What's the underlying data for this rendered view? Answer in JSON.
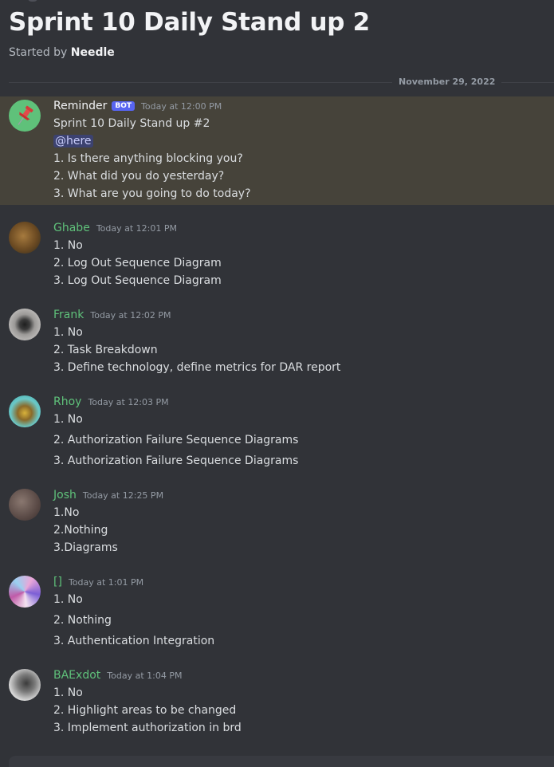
{
  "thread": {
    "title": "Sprint 10 Daily Stand up 2",
    "started_prefix": "Started by",
    "started_by": "Needle",
    "date_divider": "November 29, 2022"
  },
  "colors": {
    "author_green": "#5fc17a",
    "bot_tag": "#5865f2",
    "highlight_bg": "#46433a",
    "background": "#313338"
  },
  "messages": [
    {
      "author": "Reminder",
      "bot_tag": "BOT",
      "timestamp": "Today at 12:00 PM",
      "avatar_icon": "pushpin-icon",
      "lines": [
        "Sprint 10 Daily Stand up #2",
        "@here",
        "1. Is there anything blocking you?",
        "2. What did you do yesterday?",
        "3. What are you going to do today?"
      ]
    },
    {
      "author": "Ghabe",
      "timestamp": "Today at 12:01 PM",
      "lines": [
        "1. No",
        "2. Log Out Sequence Diagram",
        "3. Log Out Sequence Diagram"
      ]
    },
    {
      "author": "Frank",
      "timestamp": "Today at 12:02 PM",
      "lines": [
        "1. No",
        "2. Task Breakdown",
        "3. Define technology, define metrics for DAR report"
      ]
    },
    {
      "author": "Rhoy",
      "timestamp": "Today at 12:03 PM",
      "lines": [
        "1. No",
        "2. Authorization Failure Sequence Diagrams",
        "3. Authorization Failure Sequence Diagrams"
      ]
    },
    {
      "author": "Josh",
      "timestamp": "Today at 12:25 PM",
      "lines": [
        "1.No",
        "2.Nothing",
        "3.Diagrams"
      ]
    },
    {
      "author": "[]",
      "timestamp": "Today at 1:01 PM",
      "lines": [
        "1. No",
        "2. Nothing",
        "3. Authentication Integration"
      ]
    },
    {
      "author": "BAExdot",
      "timestamp": "Today at 1:04 PM",
      "lines": [
        "1. No",
        "2. Highlight areas to be changed",
        "3. Implement authorization in brd"
      ]
    }
  ]
}
